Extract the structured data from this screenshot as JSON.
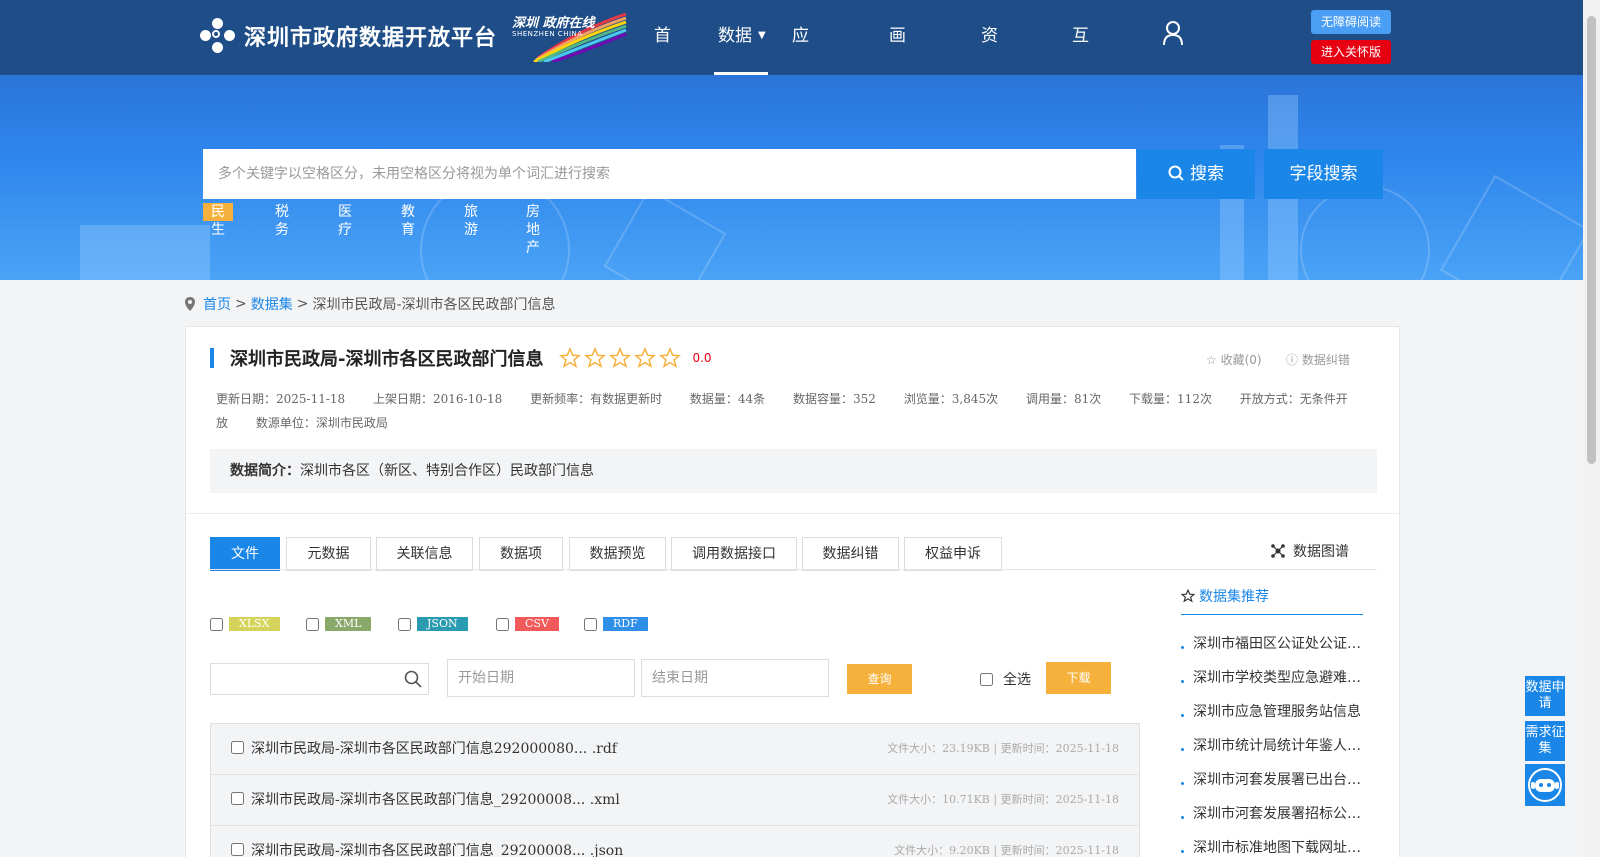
{
  "header": {
    "site_title": "深圳市政府数据开放平台",
    "badge_title": "深圳 政府在线",
    "badge_en": "SHENZHEN CHINA",
    "nav": [
      {
        "label": "首页",
        "caret": false
      },
      {
        "label": "数据",
        "caret": true
      },
      {
        "label": "应用",
        "caret": true
      },
      {
        "label": "画像",
        "caret": true
      },
      {
        "label": "资讯",
        "caret": true
      },
      {
        "label": "互动",
        "caret": true
      }
    ],
    "accessible_label": "无障碍阅读",
    "care_label": "进入关怀版"
  },
  "search": {
    "placeholder": "多个关键字以空格区分，未用空格区分将视为单个词汇进行搜索",
    "search_label": "搜索",
    "field_search_label": "字段搜索",
    "hot_tags": [
      "民生",
      "税务",
      "医疗",
      "教育",
      "旅游",
      "房地产"
    ]
  },
  "breadcrumb": {
    "home": "首页",
    "datasets": "数据集",
    "current": "深圳市民政局-深圳市各区民政部门信息"
  },
  "dataset": {
    "title": "深圳市民政局-深圳市各区民政部门信息",
    "rating": "0.0",
    "stars": 5,
    "favorite_label": "收藏(0)",
    "correction_label": "数据纠错",
    "meta": [
      "更新日期：2025-11-18",
      "上架日期：2016-10-18",
      "更新频率：有数据更新时",
      "数据量：44条",
      "数据容量：352",
      "浏览量：3,845次",
      "调用量：81次",
      "下载量：112次",
      "开放方式：无条件开放",
      "数源单位：深圳市民政局"
    ],
    "summary_label": "数据简介：",
    "summary_text": "深圳市各区（新区、特别合作区）民政部门信息"
  },
  "tabs": [
    "文件",
    "元数据",
    "关联信息",
    "数据项",
    "数据预览",
    "调用数据接口",
    "数据纠错",
    "权益申诉"
  ],
  "graph_label": "数据图谱",
  "formats": [
    {
      "label": "XLSX",
      "color": "#d4d45a"
    },
    {
      "label": "XML",
      "color": "#8aa86a"
    },
    {
      "label": "JSON",
      "color": "#2a9bb0"
    },
    {
      "label": "CSV",
      "color": "#f05a5a"
    },
    {
      "label": "RDF",
      "color": "#2f8fe8"
    }
  ],
  "filters": {
    "start_date_placeholder": "开始日期",
    "end_date_placeholder": "结束日期",
    "query_label": "查询",
    "select_all_label": "全选",
    "download_label": "下载"
  },
  "files": [
    {
      "name": "深圳市民政局-深圳市各区民政部门信息292000080... .rdf",
      "info": "文件大小：23.19KB | 更新时间：2025-11-18"
    },
    {
      "name": "深圳市民政局-深圳市各区民政部门信息_29200008... .xml",
      "info": "文件大小：10.71KB | 更新时间：2025-11-18"
    },
    {
      "name": "深圳市民政局-深圳市各区民政部门信息_29200008... .json",
      "info": "文件大小：9.20KB | 更新时间：2025-11-18"
    }
  ],
  "recommend": {
    "title": "数据集推荐",
    "items": [
      "深圳市福田区公证处公证…",
      "深圳市学校类型应急避难…",
      "深圳市应急管理服务站信息",
      "深圳市统计局统计年鉴人…",
      "深圳市河套发展署已出台…",
      "深圳市河套发展署招标公…",
      "深圳市标准地图下载网址…"
    ]
  },
  "side": {
    "apply_label": "数据申请",
    "demand_label": "需求征集"
  },
  "colors": {
    "header_bg": "#1e4d87",
    "accent": "#1a86e8",
    "orange": "#f6b13d",
    "red": "#e60012"
  }
}
